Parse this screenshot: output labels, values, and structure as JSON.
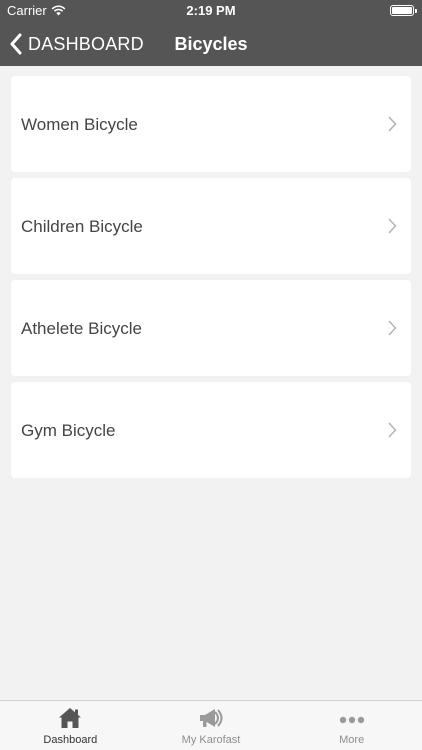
{
  "status_bar": {
    "carrier": "Carrier",
    "time": "2:19 PM"
  },
  "nav": {
    "back_label": "DASHBOARD",
    "title": "Bicycles"
  },
  "items": [
    {
      "label": "Women Bicycle"
    },
    {
      "label": "Children Bicycle"
    },
    {
      "label": "Athelete Bicycle"
    },
    {
      "label": "Gym Bicycle"
    }
  ],
  "tabs": [
    {
      "label": "Dashboard",
      "icon": "home-icon",
      "active": true
    },
    {
      "label": "My Karofast",
      "icon": "megaphone-icon",
      "active": false
    },
    {
      "label": "More",
      "icon": "more-dots-icon",
      "active": false
    }
  ],
  "colors": {
    "header": "#555555",
    "background": "#f2f2f2",
    "active_tab": "#333333",
    "inactive_tab": "#8e8e8e"
  }
}
